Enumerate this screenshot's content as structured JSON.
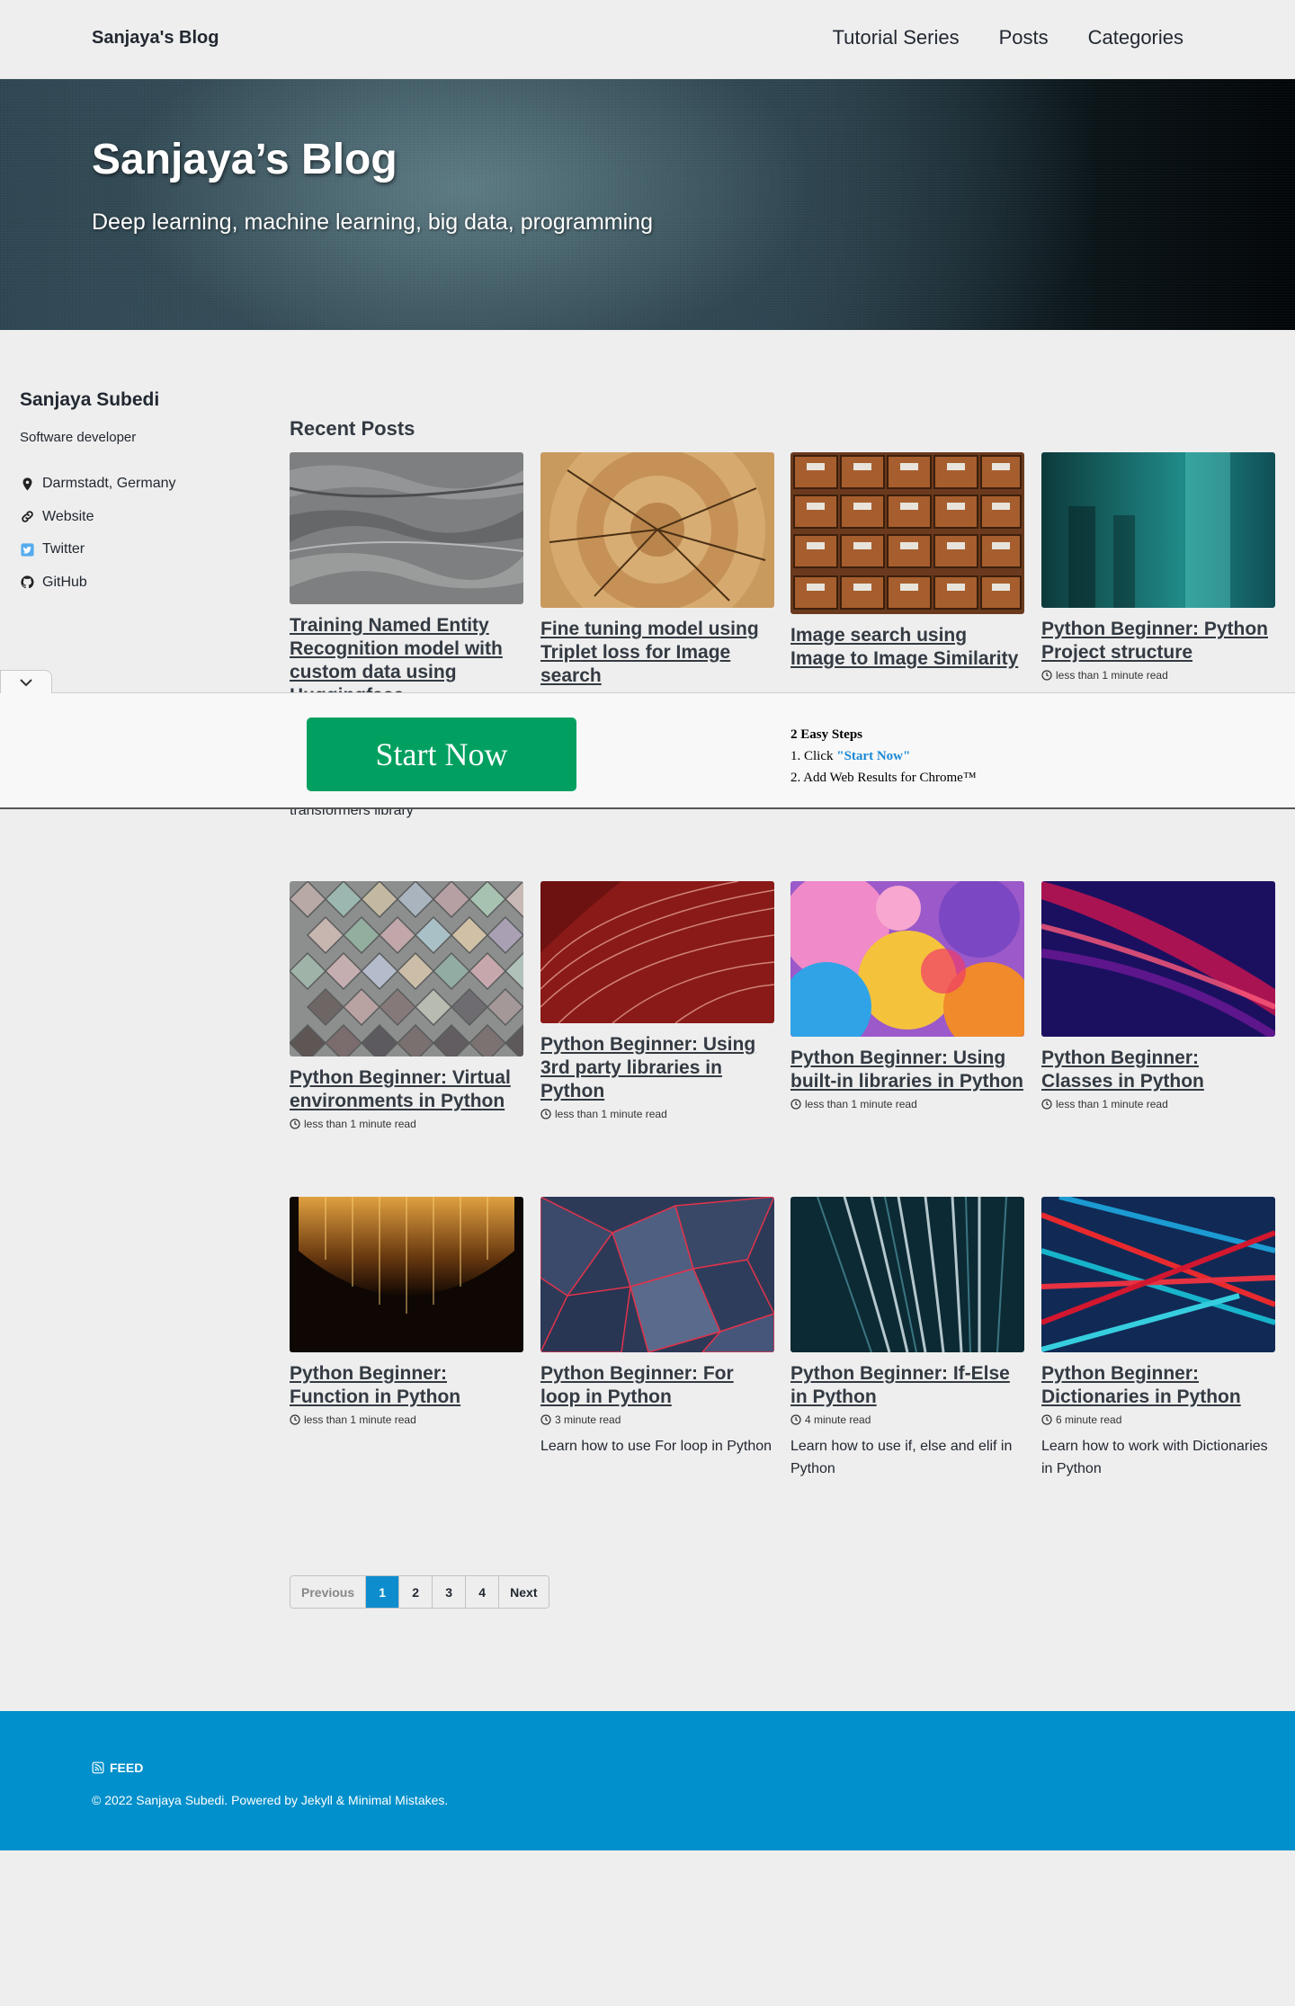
{
  "masthead": {
    "site_title": "Sanjaya's Blog",
    "nav": [
      "Tutorial Series",
      "Posts",
      "Categories"
    ]
  },
  "hero": {
    "title": "Sanjaya’s Blog",
    "tagline": "Deep learning, machine learning, big data, programming"
  },
  "author": {
    "name": "Sanjaya Subedi",
    "bio": "Software developer",
    "links": [
      {
        "label": "Darmstadt, Germany",
        "icon": "map-marker-icon"
      },
      {
        "label": "Website",
        "icon": "link-icon"
      },
      {
        "label": "Twitter",
        "icon": "twitter-icon"
      },
      {
        "label": "GitHub",
        "icon": "github-icon"
      }
    ]
  },
  "recent_posts": {
    "heading": "Recent Posts",
    "posts": [
      {
        "title": "Training Named Entity Recognition model with custom data using Huggingface",
        "read_time": "",
        "excerpt": ""
      },
      {
        "title": "Fine tuning model using Triplet loss for Image search",
        "read_time": "",
        "excerpt": ""
      },
      {
        "title": "Image search using Image to Image Similarity",
        "read_time": "",
        "excerpt": ""
      },
      {
        "title": "Python Beginner: Python Project structure",
        "read_time": "less than 1 minute read",
        "excerpt": ""
      },
      {
        "title": "Python Beginner: Virtual environments in Python",
        "read_time": "less than 1 minute read",
        "excerpt": ""
      },
      {
        "title": "Python Beginner: Using 3rd party libraries in Python",
        "read_time": "less than 1 minute read",
        "excerpt": ""
      },
      {
        "title": "Python Beginner: Using built-in libraries in Python",
        "read_time": "less than 1 minute read",
        "excerpt": ""
      },
      {
        "title": "Python Beginner: Classes in Python",
        "read_time": "less than 1 minute read",
        "excerpt": ""
      },
      {
        "title": "Python Beginner: Function in Python",
        "read_time": "less than 1 minute read",
        "excerpt": ""
      },
      {
        "title": "Python Beginner: For loop in Python",
        "read_time": "3 minute read",
        "excerpt": "Learn how to use For loop in Python"
      },
      {
        "title": "Python Beginner: If-Else in Python",
        "read_time": "4 minute read",
        "excerpt": "Learn how to use if, else and elif in Python"
      },
      {
        "title": "Python Beginner: Dictionaries in Python",
        "read_time": "6 minute read",
        "excerpt": "Learn how to work with Dictionaries in Python"
      }
    ],
    "partial_excerpt": "transformers library"
  },
  "ad": {
    "button_label": "Start Now",
    "steps_title": "2 Easy Steps",
    "step1_prefix": "1. Click ",
    "step1_link": "\"Start Now\"",
    "step2": "2. Add Web Results for Chrome™"
  },
  "pagination": {
    "previous": "Previous",
    "pages": [
      "1",
      "2",
      "3",
      "4"
    ],
    "current": "1",
    "next": "Next"
  },
  "footer": {
    "feed": "FEED",
    "copyright": "© 2022 Sanjaya Subedi. Powered by Jekyll & Minimal Mistakes."
  },
  "colors": {
    "accent": "#0090cb",
    "ad_button": "#01a060",
    "current_page": "#0d8dce"
  }
}
